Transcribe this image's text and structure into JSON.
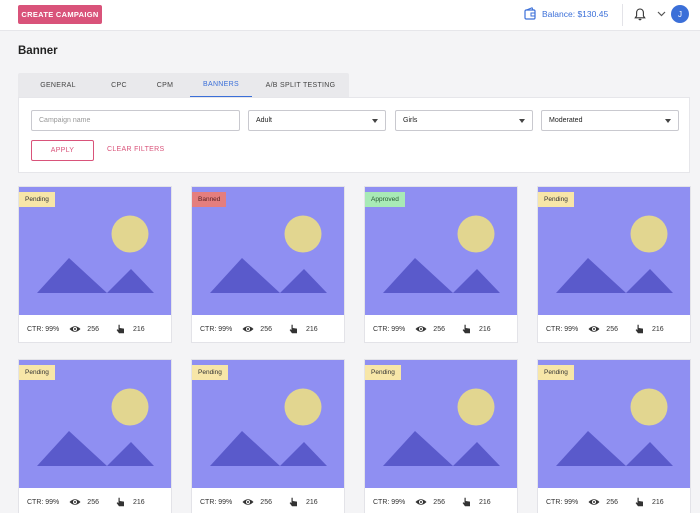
{
  "header": {
    "create_label": "CREATE CAMPAIGN",
    "balance_label": "Balance: $130.45",
    "avatar_initial": "J"
  },
  "page": {
    "title": "Banner"
  },
  "tabs": [
    {
      "label": "GENERAL",
      "active": false
    },
    {
      "label": "CPC",
      "active": false
    },
    {
      "label": "CPM",
      "active": false
    },
    {
      "label": "BANNERS",
      "active": true
    },
    {
      "label": "A/B SPLIT TESTING",
      "active": false
    }
  ],
  "filters": {
    "campaign_placeholder": "Campaign name",
    "category_value": "Adult",
    "audience_value": "Girls",
    "status_value": "Moderated",
    "apply_label": "APPLY",
    "clear_label": "CLEAR FILTERS"
  },
  "banners": [
    {
      "status": "Pending",
      "ctr": "CTR: 99%",
      "views": "256",
      "clicks": "216"
    },
    {
      "status": "Banned",
      "ctr": "CTR: 99%",
      "views": "256",
      "clicks": "216"
    },
    {
      "status": "Approved",
      "ctr": "CTR: 99%",
      "views": "256",
      "clicks": "216"
    },
    {
      "status": "Pending",
      "ctr": "CTR: 99%",
      "views": "256",
      "clicks": "216"
    },
    {
      "status": "Pending",
      "ctr": "CTR: 99%",
      "views": "256",
      "clicks": "216"
    },
    {
      "status": "Pending",
      "ctr": "CTR: 99%",
      "views": "256",
      "clicks": "216"
    },
    {
      "status": "Pending",
      "ctr": "CTR: 99%",
      "views": "256",
      "clicks": "216"
    },
    {
      "status": "Pending",
      "ctr": "CTR: 99%",
      "views": "256",
      "clicks": "216"
    }
  ],
  "colors": {
    "accent": "#d9537a",
    "link": "#3b6fd8",
    "image_bg": "#8f8ff2",
    "sun": "#e2d690",
    "mountain": "#5a5acb",
    "pending": "#f7e6a8",
    "banned": "#e47e7e",
    "approved": "#a8eab6"
  }
}
